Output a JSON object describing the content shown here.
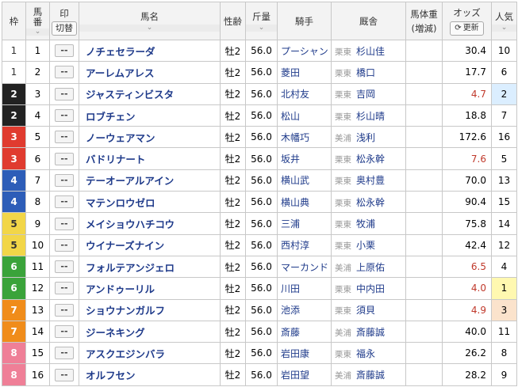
{
  "headers": {
    "waku": "枠",
    "umaban": "馬番",
    "mark": "印",
    "mark_toggle": "切替",
    "horse": "馬名",
    "sexage": "性齢",
    "weight": "斤量",
    "jockey": "騎手",
    "stable": "厩舎",
    "body_weight": "馬体重",
    "body_weight_diff": "(増減)",
    "odds": "オッズ",
    "update": "更新",
    "popularity": "人気"
  },
  "waku_colors": {
    "1": "#ffffff",
    "2": "#222222",
    "3": "#e03b2f",
    "4": "#2d5db8",
    "5": "#f2d648",
    "6": "#3aa33a",
    "7": "#f08c1a",
    "8": "#ef7f97"
  },
  "mark_placeholder": "--",
  "rows": [
    {
      "waku": "1",
      "umaban": "1",
      "horse": "ノチェセラーダ",
      "sexage": "牡2",
      "weight": "56.0",
      "jockey": "プーシャン",
      "area": "栗東",
      "trainer": "杉山佳",
      "odds": "30.4",
      "pop": "10",
      "fav": false
    },
    {
      "waku": "1",
      "umaban": "2",
      "horse": "アーレムアレス",
      "sexage": "牡2",
      "weight": "56.0",
      "jockey": "菱田",
      "area": "栗東",
      "trainer": "橋口",
      "odds": "17.7",
      "pop": "6",
      "fav": false
    },
    {
      "waku": "2",
      "umaban": "3",
      "horse": "ジャスティンビスタ",
      "sexage": "牡2",
      "weight": "56.0",
      "jockey": "北村友",
      "area": "栗東",
      "trainer": "吉岡",
      "odds": "4.7",
      "pop": "2",
      "fav": true
    },
    {
      "waku": "2",
      "umaban": "4",
      "horse": "ロブチェン",
      "sexage": "牡2",
      "weight": "56.0",
      "jockey": "松山",
      "area": "栗東",
      "trainer": "杉山晴",
      "odds": "18.8",
      "pop": "7",
      "fav": false
    },
    {
      "waku": "3",
      "umaban": "5",
      "horse": "ノーウェアマン",
      "sexage": "牡2",
      "weight": "56.0",
      "jockey": "木幡巧",
      "area": "美浦",
      "trainer": "浅利",
      "odds": "172.6",
      "pop": "16",
      "fav": false
    },
    {
      "waku": "3",
      "umaban": "6",
      "horse": "バドリナート",
      "sexage": "牡2",
      "weight": "56.0",
      "jockey": "坂井",
      "area": "栗東",
      "trainer": "松永幹",
      "odds": "7.6",
      "pop": "5",
      "fav": true
    },
    {
      "waku": "4",
      "umaban": "7",
      "horse": "テーオーアルアイン",
      "sexage": "牡2",
      "weight": "56.0",
      "jockey": "横山武",
      "area": "栗東",
      "trainer": "奥村豊",
      "odds": "70.0",
      "pop": "13",
      "fav": false
    },
    {
      "waku": "4",
      "umaban": "8",
      "horse": "マテンロウゼロ",
      "sexage": "牡2",
      "weight": "56.0",
      "jockey": "横山典",
      "area": "栗東",
      "trainer": "松永幹",
      "odds": "90.4",
      "pop": "15",
      "fav": false
    },
    {
      "waku": "5",
      "umaban": "9",
      "horse": "メイショウハチコウ",
      "sexage": "牡2",
      "weight": "56.0",
      "jockey": "三浦",
      "area": "栗東",
      "trainer": "牧浦",
      "odds": "75.8",
      "pop": "14",
      "fav": false
    },
    {
      "waku": "5",
      "umaban": "10",
      "horse": "ウイナーズナイン",
      "sexage": "牡2",
      "weight": "56.0",
      "jockey": "西村淳",
      "area": "栗東",
      "trainer": "小栗",
      "odds": "42.4",
      "pop": "12",
      "fav": false
    },
    {
      "waku": "6",
      "umaban": "11",
      "horse": "フォルテアンジェロ",
      "sexage": "牡2",
      "weight": "56.0",
      "jockey": "マーカンド",
      "area": "美浦",
      "trainer": "上原佑",
      "odds": "6.5",
      "pop": "4",
      "fav": true
    },
    {
      "waku": "6",
      "umaban": "12",
      "horse": "アンドゥーリル",
      "sexage": "牡2",
      "weight": "56.0",
      "jockey": "川田",
      "area": "栗東",
      "trainer": "中内田",
      "odds": "4.0",
      "pop": "1",
      "fav": true
    },
    {
      "waku": "7",
      "umaban": "13",
      "horse": "ショウナンガルフ",
      "sexage": "牡2",
      "weight": "56.0",
      "jockey": "池添",
      "area": "栗東",
      "trainer": "須貝",
      "odds": "4.9",
      "pop": "3",
      "fav": true
    },
    {
      "waku": "7",
      "umaban": "14",
      "horse": "ジーネキング",
      "sexage": "牡2",
      "weight": "56.0",
      "jockey": "斎藤",
      "area": "美浦",
      "trainer": "斎藤誠",
      "odds": "40.0",
      "pop": "11",
      "fav": false
    },
    {
      "waku": "8",
      "umaban": "15",
      "horse": "アスクエジンバラ",
      "sexage": "牡2",
      "weight": "56.0",
      "jockey": "岩田康",
      "area": "栗東",
      "trainer": "福永",
      "odds": "26.2",
      "pop": "8",
      "fav": false
    },
    {
      "waku": "8",
      "umaban": "16",
      "horse": "オルフセン",
      "sexage": "牡2",
      "weight": "56.0",
      "jockey": "岩田望",
      "area": "美浦",
      "trainer": "斎藤誠",
      "odds": "28.2",
      "pop": "9",
      "fav": false
    }
  ]
}
